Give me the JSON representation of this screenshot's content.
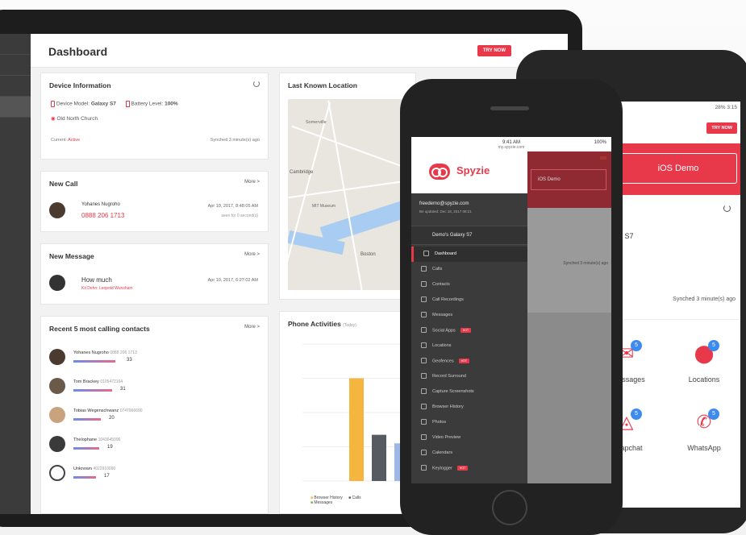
{
  "tablet": {
    "title": "Dashboard",
    "try_now": "TRY NOW",
    "device_info": {
      "title": "Device Information",
      "model_label": "Device Model:",
      "model_value": "Galaxy S7",
      "battery_label": "Battery Level:",
      "battery_value": "100%",
      "location": "Old North Church",
      "current_label": "Current:",
      "current_value": "Active",
      "synched": "Synched 3 minute(s) ago"
    },
    "new_call": {
      "title": "New Call",
      "more": "More >",
      "name": "Yohanes Nugroho",
      "phone": "0888 206 1713",
      "date": "Apr 10, 2017, 8:48:05 AM",
      "sub": "seen for 0 second(s)"
    },
    "new_message": {
      "title": "New Message",
      "more": "More >",
      "text": "How much",
      "sub": "Kit Dehn: Leopold Wunsham",
      "date": "Apr 10, 2017, 6:27:02 AM"
    },
    "recent_contacts": {
      "title": "Recent 5 most calling contacts",
      "more": "More >",
      "items": [
        {
          "name": "Yohanes Nugroho",
          "phone": "0888 206 1713",
          "count": "33"
        },
        {
          "name": "Tom Brackey",
          "phone": "0105472164",
          "count": "31"
        },
        {
          "name": "Tobias Wegenschwanz",
          "phone": "0747966690",
          "count": "20"
        },
        {
          "name": "Thelophane",
          "phone": "1043645096",
          "count": "19"
        },
        {
          "name": "Unknown",
          "phone": "4022910090",
          "count": "17"
        }
      ]
    },
    "location": {
      "title": "Last Known Location",
      "map_labels": [
        "Somerville",
        "Cambridge",
        "MIT Museum",
        "Boston"
      ]
    },
    "activities": {
      "title": "Phone Activities",
      "sub": "(Today)",
      "legend": [
        "Browser History",
        "Calls",
        "Messages"
      ]
    }
  },
  "iphone": {
    "time": "9:41 AM",
    "battery": "100%",
    "url": "my.spyzie.com",
    "brand": "Spyzie",
    "email": "freedemo@spyzie.com",
    "last_update": "Be updated: Dec 18, 2017 08:21",
    "device": "Demo's Galaxy S7",
    "overlay_demo": "iOS Demo",
    "overlay_synched": "Synched 3 minute(s) ago",
    "menu": [
      {
        "label": "Dashboard",
        "hot": ""
      },
      {
        "label": "Calls",
        "hot": ""
      },
      {
        "label": "Contacts",
        "hot": ""
      },
      {
        "label": "Call Recordings",
        "hot": ""
      },
      {
        "label": "Messages",
        "hot": ""
      },
      {
        "label": "Social Apps",
        "hot": "HOT"
      },
      {
        "label": "Locations",
        "hot": ""
      },
      {
        "label": "Geofences",
        "hot": "HOT"
      },
      {
        "label": "Record Surround",
        "hot": ""
      },
      {
        "label": "Capture Screenshots",
        "hot": ""
      },
      {
        "label": "Browser History",
        "hot": ""
      },
      {
        "label": "Photos",
        "hot": ""
      },
      {
        "label": "Video Preview",
        "hot": ""
      },
      {
        "label": "Calendars",
        "hot": ""
      },
      {
        "label": "Keylogger",
        "hot": "HOT"
      }
    ]
  },
  "android": {
    "status": "28% 3:15",
    "try_now": "TRY NOW",
    "demo": "iOS Demo",
    "device": "axy S7",
    "battery": "%",
    "synched": "Synched 3 minute(s) ago",
    "apps": [
      {
        "label": "essages",
        "badge": "5"
      },
      {
        "label": "Locations",
        "badge": "5"
      },
      {
        "label": "apchat",
        "badge": "5"
      },
      {
        "label": "WhatsApp",
        "badge": "5"
      }
    ]
  },
  "chart_data": {
    "type": "bar",
    "title": "Phone Activities",
    "categories": [
      "Browser History",
      "Calls",
      "Messages"
    ],
    "values": [
      60,
      27,
      22
    ],
    "ylim": [
      0,
      80
    ],
    "colors": {
      "Browser History": "#f4b63f",
      "Calls": "#555b61",
      "Messages": "#9db7e8"
    }
  }
}
